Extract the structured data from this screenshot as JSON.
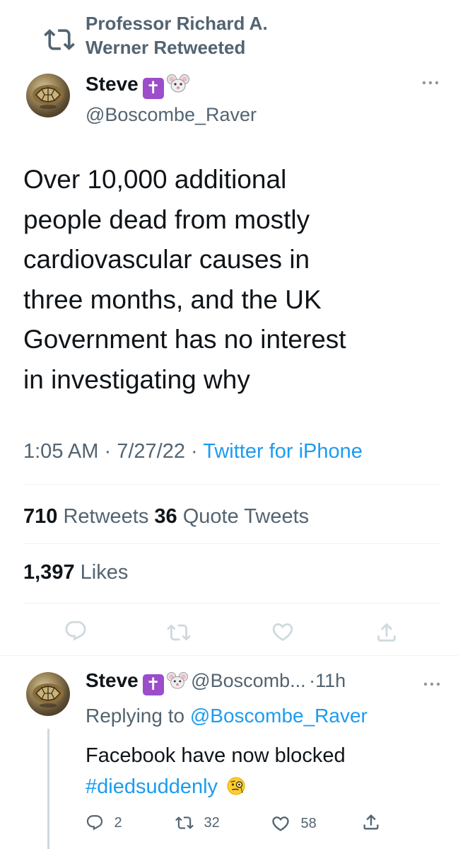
{
  "retweet_header": {
    "line1": "Professor Richard A.",
    "line2": "Werner Retweeted"
  },
  "tweet": {
    "author_name": "Steve",
    "handle": "@Boscombe_Raver",
    "text": "Over 10,000 additional\npeople dead from mostly\ncardiovascular causes in\nthree months, and the UK\nGovernment has no interest\nin investigating why",
    "time": "1:05 AM",
    "date": "7/27/22",
    "separator": "·",
    "source": "Twitter for iPhone",
    "retweets_count": "710",
    "retweets_label": "Retweets",
    "quotes_count": "36",
    "quotes_label": "Quote Tweets",
    "likes_count": "1,397",
    "likes_label": "Likes"
  },
  "reply": {
    "author_name": "Steve",
    "handle": "@Boscomb...",
    "time": "·11h",
    "replying_prefix": "Replying to",
    "replying_to": "@Boscombe_Raver",
    "text_line1": "Facebook have now blocked",
    "hashtag": "#diedsuddenly",
    "replies_count": "2",
    "retweets_count": "32",
    "likes_count": "58"
  },
  "colors": {
    "text": "#0f1419",
    "secondary": "#536471",
    "accent": "#1d9bf0",
    "divider": "#eff3f4"
  }
}
